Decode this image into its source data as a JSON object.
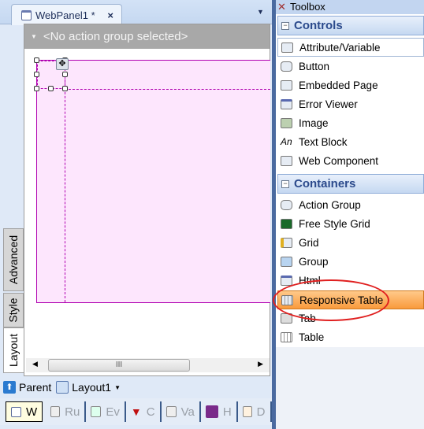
{
  "document": {
    "tab_title": "WebPanel1 *",
    "close": "×",
    "action_group": "<No action group selected>"
  },
  "side_tabs": [
    "Advanced",
    "Style",
    "Layout"
  ],
  "scrollbar": {
    "grip": "III"
  },
  "parent_bar": {
    "parent": "Parent",
    "layout": "Layout1"
  },
  "bottom_tabs": [
    {
      "label": "W",
      "selected": true
    },
    {
      "label": "Ru"
    },
    {
      "label": "Ev"
    },
    {
      "label": "C"
    },
    {
      "label": "Va"
    },
    {
      "label": "H"
    },
    {
      "label": "D"
    }
  ],
  "toolbox": {
    "title": "Toolbox",
    "sections": [
      {
        "title": "Controls",
        "items": [
          "Attribute/Variable",
          "Button",
          "Embedded Page",
          "Error Viewer",
          "Image",
          "Text Block",
          "Web Component"
        ]
      },
      {
        "title": "Containers",
        "items": [
          "Action Group",
          "Free Style Grid",
          "Grid",
          "Group",
          "Html",
          "Responsive Table",
          "Tab",
          "Table"
        ]
      }
    ],
    "highlighted": "Responsive Table",
    "annotation_color": "#e02020",
    "highlight_color": "#f99a3c"
  }
}
